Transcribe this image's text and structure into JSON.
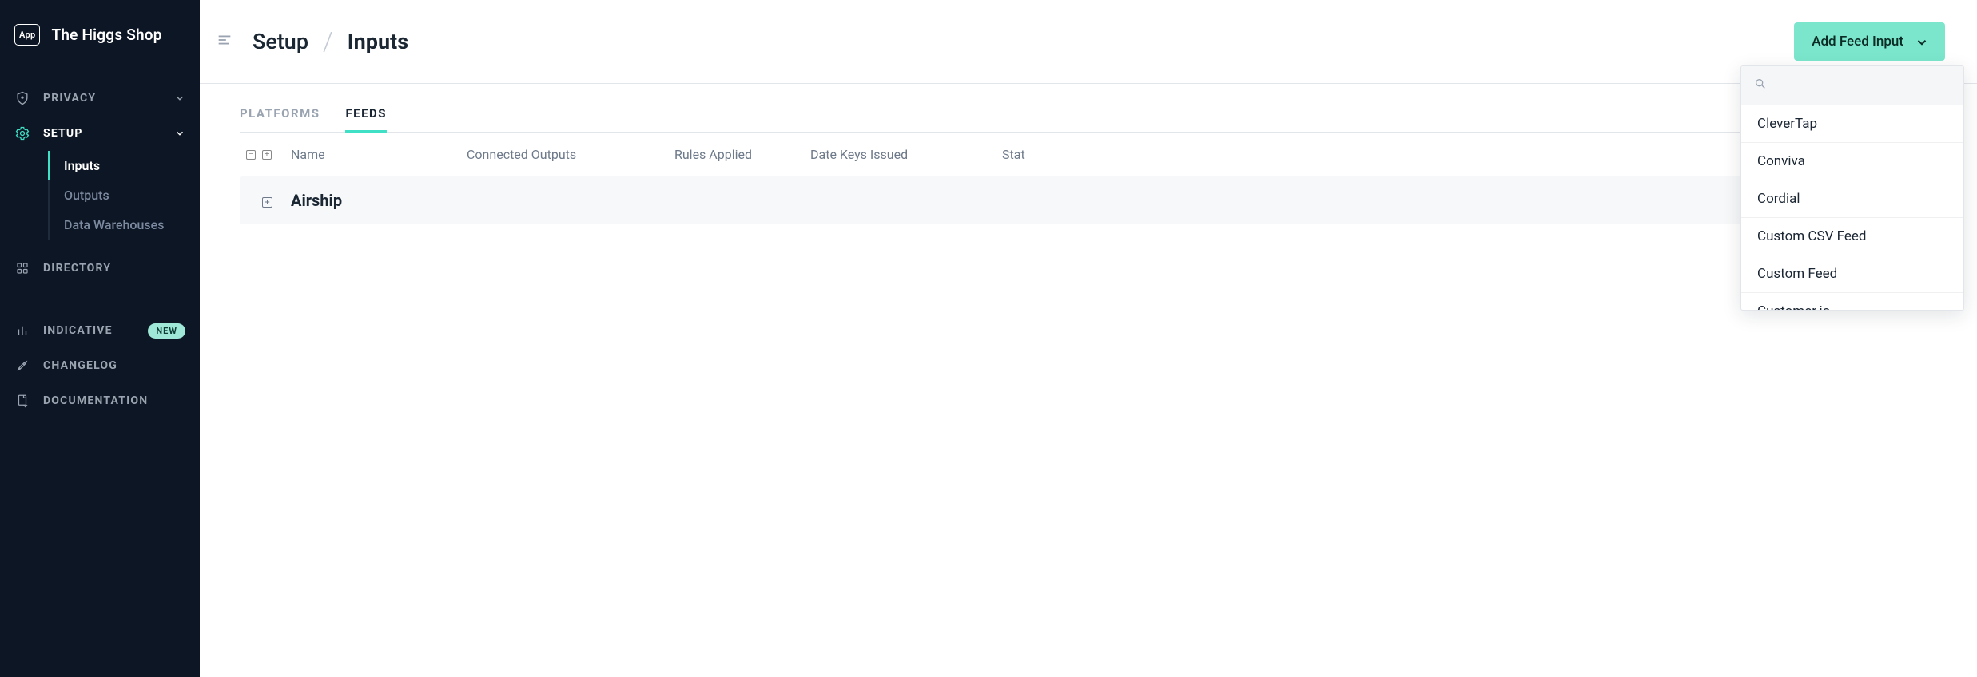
{
  "app_badge": "App",
  "app_title": "The Higgs Shop",
  "sidebar": {
    "privacy": "PRIVACY",
    "setup": "SETUP",
    "setup_children": {
      "inputs": "Inputs",
      "outputs": "Outputs",
      "data_warehouses": "Data Warehouses"
    },
    "directory": "DIRECTORY",
    "indicative": "INDICATIVE",
    "indicative_badge": "NEW",
    "changelog": "CHANGELOG",
    "documentation": "DOCUMENTATION"
  },
  "breadcrumb": {
    "parent": "Setup",
    "current": "Inputs"
  },
  "add_button_label": "Add Feed Input",
  "tabs": {
    "platforms": "PLATFORMS",
    "feeds": "FEEDS"
  },
  "table": {
    "headers": {
      "name": "Name",
      "connected_outputs": "Connected Outputs",
      "rules_applied": "Rules Applied",
      "date_keys_issued": "Date Keys Issued",
      "status": "Stat"
    },
    "rows": [
      {
        "name": "Airship"
      }
    ]
  },
  "dropdown": {
    "search_placeholder": "",
    "items": [
      "CleverTap",
      "Conviva",
      "Cordial",
      "Custom CSV Feed",
      "Custom Feed",
      "Customer.io"
    ]
  }
}
